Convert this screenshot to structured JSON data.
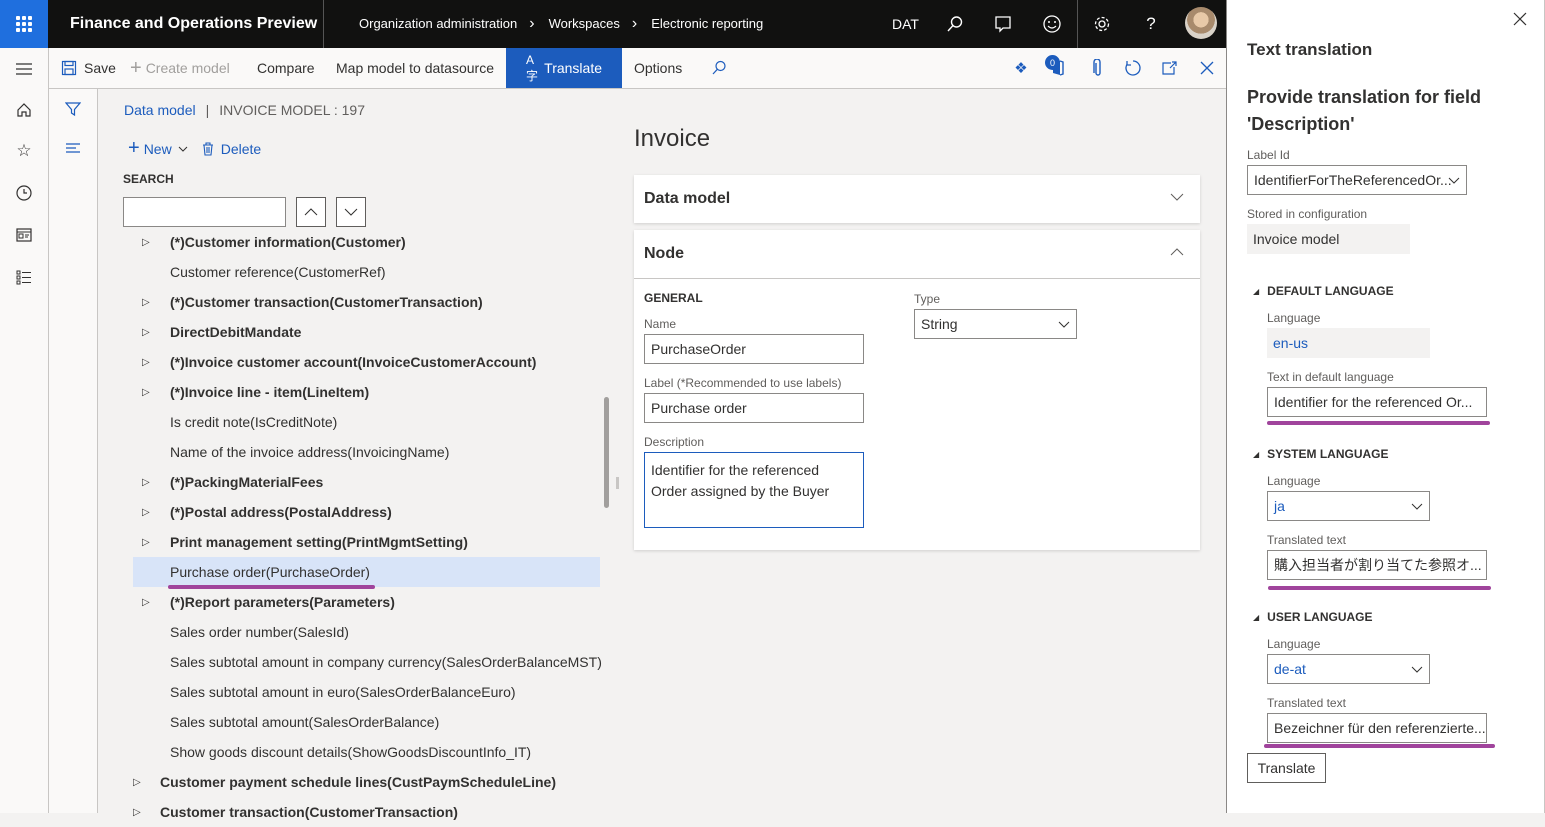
{
  "app": {
    "title": "Finance and Operations Preview",
    "breadcrumb": [
      "Organization administration",
      "Workspaces",
      "Electronic reporting"
    ],
    "company": "DAT"
  },
  "toolbar": {
    "save": "Save",
    "create_model": "Create model",
    "compare": "Compare",
    "map_model": "Map model to datasource",
    "translate": "Translate",
    "options": "Options",
    "attachments_count": "0"
  },
  "tree": {
    "header_link": "Data model",
    "header_sep": "|",
    "model_name": "INVOICE MODEL : 197",
    "new_label": "New",
    "delete_label": "Delete",
    "search_label": "SEARCH",
    "search_value": "",
    "rows": [
      {
        "label": "(*)Customer information(Customer)",
        "expandable": true,
        "bold": true
      },
      {
        "label": "Customer reference(CustomerRef)",
        "expandable": false,
        "bold": false
      },
      {
        "label": "(*)Customer transaction(CustomerTransaction)",
        "expandable": true,
        "bold": true
      },
      {
        "label": "DirectDebitMandate",
        "expandable": true,
        "bold": true
      },
      {
        "label": "(*)Invoice customer account(InvoiceCustomerAccount)",
        "expandable": true,
        "bold": true
      },
      {
        "label": "(*)Invoice line - item(LineItem)",
        "expandable": true,
        "bold": true
      },
      {
        "label": "Is credit note(IsCreditNote)",
        "expandable": false,
        "bold": false
      },
      {
        "label": "Name of the invoice address(InvoicingName)",
        "expandable": false,
        "bold": false
      },
      {
        "label": "(*)PackingMaterialFees",
        "expandable": true,
        "bold": true
      },
      {
        "label": "(*)Postal address(PostalAddress)",
        "expandable": true,
        "bold": true
      },
      {
        "label": "Print management setting(PrintMgmtSetting)",
        "expandable": true,
        "bold": true
      },
      {
        "label": "Purchase order(PurchaseOrder)",
        "expandable": false,
        "bold": false,
        "selected": true
      },
      {
        "label": "(*)Report parameters(Parameters)",
        "expandable": true,
        "bold": true
      },
      {
        "label": "Sales order number(SalesId)",
        "expandable": false,
        "bold": false
      },
      {
        "label": "Sales subtotal amount in company currency(SalesOrderBalanceMST)",
        "expandable": false,
        "bold": false
      },
      {
        "label": "Sales subtotal amount in euro(SalesOrderBalanceEuro)",
        "expandable": false,
        "bold": false
      },
      {
        "label": "Sales subtotal amount(SalesOrderBalance)",
        "expandable": false,
        "bold": false
      },
      {
        "label": "Show goods discount details(ShowGoodsDiscountInfo_IT)",
        "expandable": false,
        "bold": false
      },
      {
        "label": "Customer payment schedule lines(CustPaymScheduleLine)",
        "expandable": true,
        "bold": true,
        "top": true
      },
      {
        "label": "Customer transaction(CustomerTransaction)",
        "expandable": true,
        "bold": true,
        "top": true
      }
    ]
  },
  "detail": {
    "title": "Invoice",
    "data_model_tab": "Data model",
    "node_tab": "Node",
    "general": "GENERAL",
    "name_label": "Name",
    "name_value": "PurchaseOrder",
    "label_label": "Label (*Recommended to use labels)",
    "label_value": "Purchase order",
    "description_label": "Description",
    "description_value": "Identifier for the referenced Order assigned by the Buyer",
    "type_label": "Type",
    "type_value": "String"
  },
  "panel": {
    "title": "Text translation",
    "heading": "Provide translation for field 'Description'",
    "label_id_label": "Label Id",
    "label_id_value": "IdentifierForTheReferencedOr...",
    "stored_label": "Stored in configuration",
    "stored_value": "Invoice model",
    "default_section": "DEFAULT LANGUAGE",
    "default_lang_label": "Language",
    "default_lang_value": "en-us",
    "default_text_label": "Text in default language",
    "default_text_value": "Identifier for the referenced Or...",
    "system_section": "SYSTEM LANGUAGE",
    "system_lang_label": "Language",
    "system_lang_value": "ja",
    "system_text_label": "Translated text",
    "system_text_value": "購入担当者が割り当てた参照オ...",
    "user_section": "USER LANGUAGE",
    "user_lang_label": "Language",
    "user_lang_value": "de-at",
    "user_text_label": "Translated text",
    "user_text_value": "Bezeichner für den referenzierte...",
    "translate_button": "Translate"
  },
  "colors": {
    "accent": "#1c5cbd",
    "waffle": "#1f6fde",
    "highlight_underline": "#a0449c",
    "selected_row": "#d8e4f8"
  }
}
